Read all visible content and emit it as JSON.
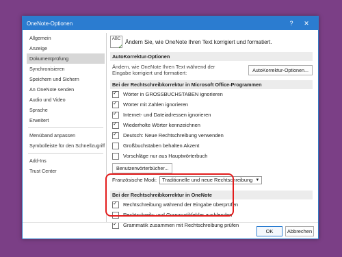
{
  "window": {
    "title": "OneNote-Optionen",
    "help": "?",
    "close": "✕"
  },
  "sidebar": {
    "group1": [
      "Allgemein",
      "Anzeige",
      "Dokumentprüfung",
      "Synchronisieren",
      "Speichern und Sichern",
      "An OneNote senden",
      "Audio und Video",
      "Sprache",
      "Erweitert"
    ],
    "group2": [
      "Menüband anpassen",
      "Symbolleiste für den Schnellzugriff"
    ],
    "group3": [
      "Add-Ins",
      "Trust Center"
    ],
    "selected": "Dokumentprüfung"
  },
  "intro": {
    "icon_text": "ABC",
    "text": "Ändern Sie, wie OneNote Ihren Text korrigiert und formatiert."
  },
  "autocorrect": {
    "header": "AutoKorrektur-Optionen",
    "desc": "Ändern, wie OneNote Ihren Text während der Eingabe korrigiert und formatiert:",
    "button": "AutoKorrektur-Optionen..."
  },
  "office": {
    "header": "Bei der Rechtschreibkorrektur in Microsoft Office-Programmen",
    "options": [
      {
        "label": "Wörter in GROSSBUCHSTABEN ignorieren",
        "checked": true
      },
      {
        "label": "Wörter mit Zahlen ignorieren",
        "checked": true
      },
      {
        "label": "Internet- und Dateiadressen ignorieren",
        "checked": true
      },
      {
        "label": "Wiederholte Wörter kennzeichnen",
        "checked": true
      },
      {
        "label": "Deutsch: Neue Rechtschreibung verwenden",
        "checked": true
      },
      {
        "label": "Großbuchstaben behalten Akzent",
        "checked": false
      },
      {
        "label": "Vorschläge nur aus Hauptwörterbuch",
        "checked": false
      }
    ],
    "dict_button": "Benutzerwörterbücher...",
    "mode_label": "Französische Modi:",
    "mode_value": "Traditionelle und neue Rechtschreibung"
  },
  "onenote": {
    "header": "Bei der Rechtschreibkorrektur in OneNote",
    "options": [
      {
        "label": "Rechtschreibung während der Eingabe überprüfen",
        "checked": true
      },
      {
        "label": "Rechtschreib- und Grammatikfehler ausblenden",
        "checked": false
      },
      {
        "label": "Grammatik zusammen mit Rechtschreibung prüfen",
        "checked": true
      }
    ]
  },
  "footer": {
    "ok": "OK",
    "cancel": "Abbrechen"
  },
  "colors": {
    "titlebar": "#2b7cd0",
    "highlight": "#e31b1b",
    "background": "#7b3f86"
  }
}
